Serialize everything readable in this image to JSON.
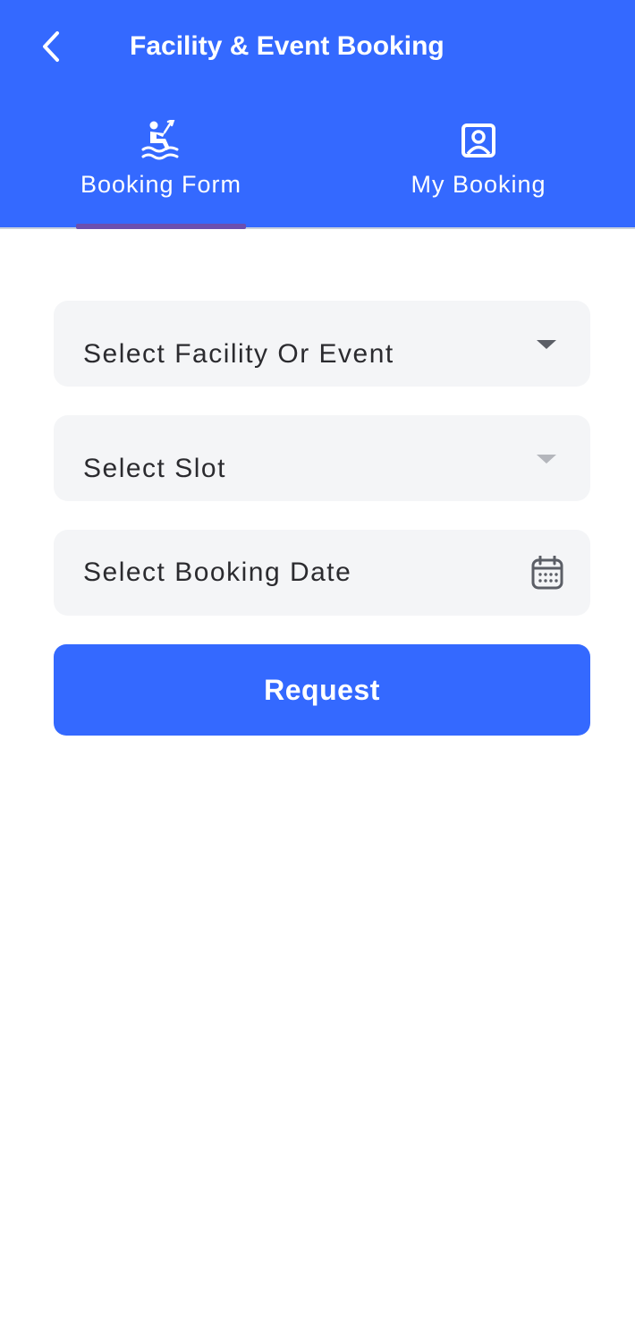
{
  "header": {
    "title": "Facility & Event Booking",
    "back_icon": "chevron-left-icon",
    "background_color": "#3469FF"
  },
  "tabs": [
    {
      "label": "Booking Form",
      "icon": "kayak-person-icon",
      "active": true
    },
    {
      "label": "My Booking",
      "icon": "user-portrait-icon",
      "active": false
    }
  ],
  "form": {
    "facility_select": {
      "label": "Select Facility Or Event",
      "icon": "caret-down-icon"
    },
    "slot_select": {
      "label": "Select Slot",
      "icon": "caret-down-icon",
      "disabled": true
    },
    "date_field": {
      "label": "Select Booking Date",
      "icon": "calendar-icon"
    },
    "submit_label": "Request"
  },
  "colors": {
    "primary": "#3469FF",
    "tab_indicator": "#6b4fb0",
    "field_background": "#f4f5f7",
    "text": "#2b2b2f"
  }
}
